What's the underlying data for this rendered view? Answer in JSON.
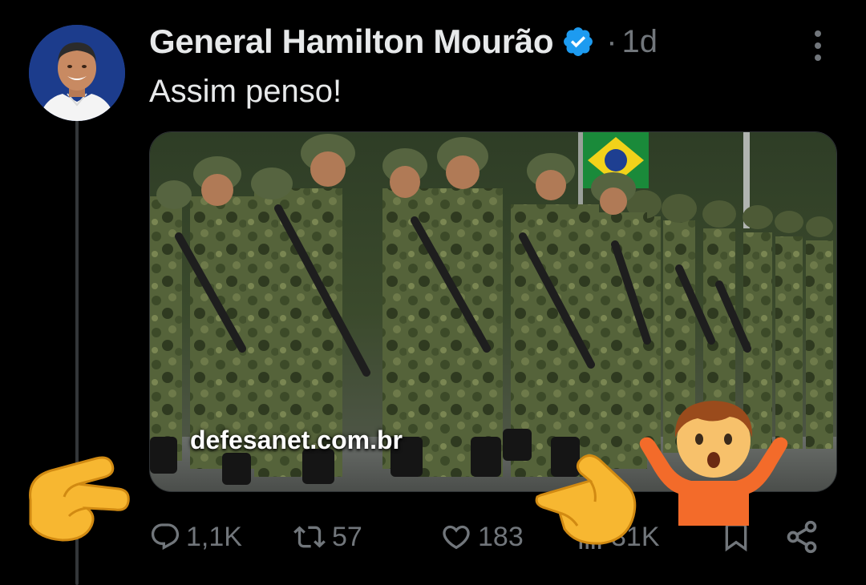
{
  "post": {
    "author_name": "General Hamilton Mourão",
    "separator": "·",
    "time": "1d",
    "text": "Assim penso!"
  },
  "media": {
    "watermark": "defesanet.com.br"
  },
  "actions": {
    "replies": "1,1K",
    "reposts": "57",
    "likes": "183",
    "views": "31K"
  },
  "icons": {
    "verified": "verified-badge-icon",
    "more": "more-options-icon",
    "reply": "reply-icon",
    "repost": "repost-icon",
    "like": "like-icon",
    "views": "views-icon",
    "bookmark": "bookmark-icon",
    "share": "share-icon",
    "overlay_1": "backhand-index-pointing-right-emoji",
    "overlay_2": "backhand-index-pointing-right-emoji",
    "overlay_3": "person-shrugging-emoji"
  },
  "colors": {
    "background": "#000000",
    "text": "#e7e9ea",
    "muted": "#71767b",
    "verified": "#1d9bf0",
    "camo": "#4a5a34"
  }
}
